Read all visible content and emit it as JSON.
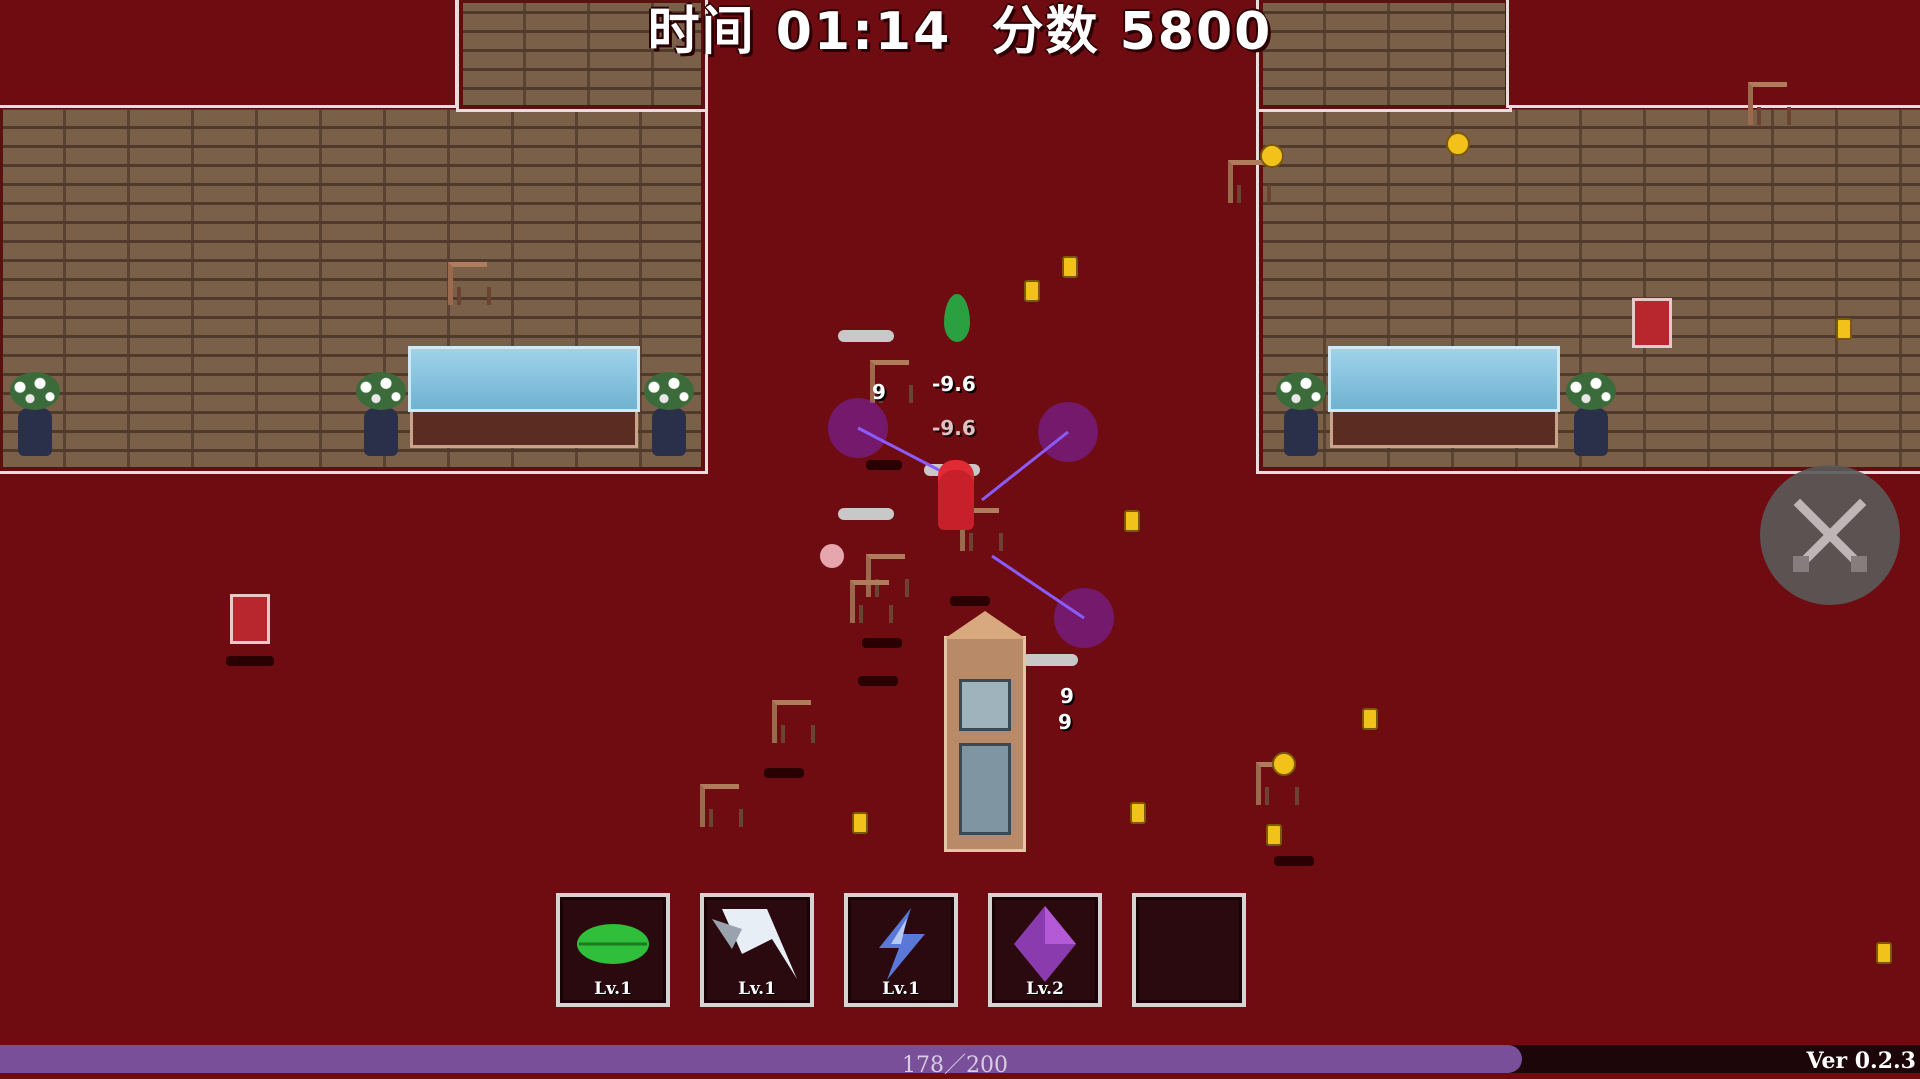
{
  "hud": {
    "time_label": "时间",
    "time_value": "01:14",
    "score_label": "分数",
    "score_value": "5800"
  },
  "skills": [
    {
      "name": "leaf",
      "icon": "leaf-icon",
      "level": "Lv.1"
    },
    {
      "name": "wind-slash",
      "icon": "wind-slash-icon",
      "level": "Lv.1"
    },
    {
      "name": "lightning",
      "icon": "lightning-icon",
      "level": "Lv.1"
    },
    {
      "name": "crystal",
      "icon": "crystal-icon",
      "level": "Lv.2"
    },
    {
      "name": "empty",
      "icon": "",
      "level": ""
    }
  ],
  "xp": {
    "text": "178／200",
    "current": 178,
    "max": 200
  },
  "version": "Ver 0.2.3",
  "damage_numbers": [
    "-9.6",
    "-9.6",
    "9",
    "9",
    "9"
  ],
  "colors": {
    "floor": "#6f0c12",
    "xp_fill": "#7a4f9a",
    "coin": "#f2c21a"
  },
  "attack_button_icon": "crossed-swords-icon"
}
